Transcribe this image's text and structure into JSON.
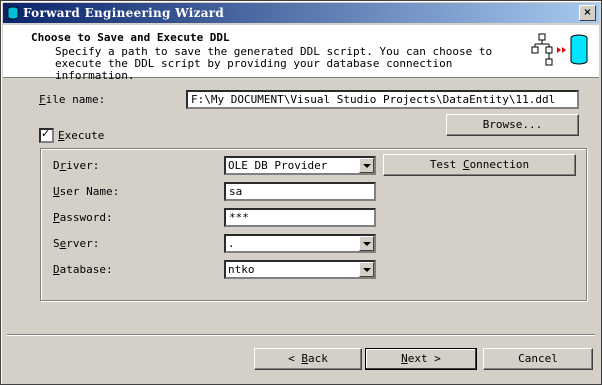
{
  "window": {
    "title": "Forward Engineering Wizard",
    "close_glyph": "×"
  },
  "header": {
    "title": "Choose to Save and Execute DDL",
    "description": "Specify a path to save the generated DDL script.  You can choose to execute the DDL script by providing your database connection information."
  },
  "file": {
    "label_prefix": "",
    "label_hotkey": "F",
    "label_rest": "ile name:",
    "value": "F:\\My DOCUMENT\\Visual Studio Projects\\DataEntity\\11.ddl",
    "browse_label": "Browse..."
  },
  "execute": {
    "checked": true,
    "label_hotkey": "E",
    "label_rest": "xecute"
  },
  "connection": {
    "driver_label_a": "D",
    "driver_label_b": "r",
    "driver_label_c": "iver:",
    "driver_value": "OLE DB Provider",
    "test_label_a": "Test ",
    "test_label_b": "C",
    "test_label_c": "onnection",
    "username_label_a": "U",
    "username_label_b": "ser Name:",
    "username_value": "sa",
    "password_label_a": "P",
    "password_label_b": "assword:",
    "password_value": "***",
    "server_label_a": "S",
    "server_label_b": "e",
    "server_label_c": "rver:",
    "server_value": ".",
    "database_label_a": "D",
    "database_label_b": "atabase:",
    "database_value": "ntko"
  },
  "footer": {
    "back_arrow": "<",
    "back_hotkey": "B",
    "back_rest": "ack",
    "next_hotkey": "N",
    "next_rest": "ext",
    "next_arrow": ">",
    "cancel_label": "Cancel"
  },
  "colors": {
    "titlebar_start": "#0a246a",
    "titlebar_end": "#a6caf0",
    "dialog_face": "#d4d0c8",
    "wizard_icon_accent": "#00bcd4",
    "wizard_arrow": "#e00000"
  }
}
